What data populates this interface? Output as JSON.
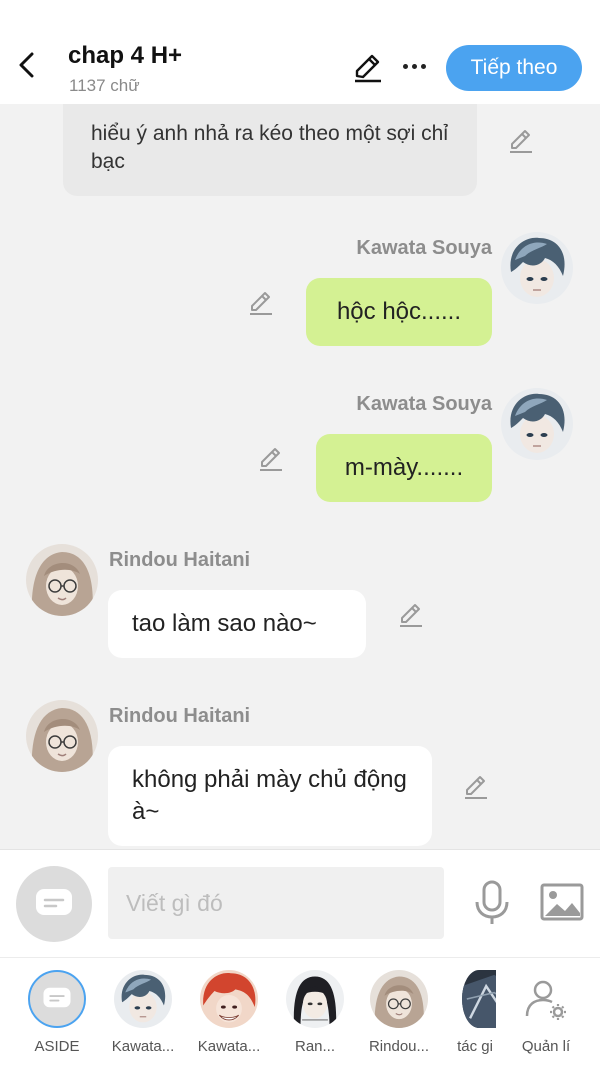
{
  "header": {
    "title": "chap 4 H+",
    "subtitle": "1137 chữ",
    "next_label": "Tiếp theo"
  },
  "messages": [
    {
      "type": "grey",
      "text": "hiểu ý anh nhả ra kéo theo một sợi chỉ bạc"
    },
    {
      "speaker": "Kawata Souya",
      "side": "right",
      "text": "hộc hộc......"
    },
    {
      "speaker": "Kawata Souya",
      "side": "right",
      "text": "m-mày......."
    },
    {
      "speaker": "Rindou Haitani",
      "side": "left",
      "text": "tao làm sao nào~"
    },
    {
      "speaker": "Rindou Haitani",
      "side": "left",
      "text": "không phải mày chủ động à~"
    }
  ],
  "input": {
    "placeholder": "Viết gì đó"
  },
  "cast": [
    {
      "label": "ASIDE"
    },
    {
      "label": "Kawata..."
    },
    {
      "label": "Kawata..."
    },
    {
      "label": "Ran..."
    },
    {
      "label": "Rindou..."
    },
    {
      "label": "tác gi"
    },
    {
      "label": "Quản lí"
    }
  ],
  "colors": {
    "accent": "#4ba3f0",
    "bubble_right": "#d4f193",
    "bubble_left": "#ffffff",
    "bubble_aside": "#e9e9e9",
    "background": "#f2f2f2"
  }
}
